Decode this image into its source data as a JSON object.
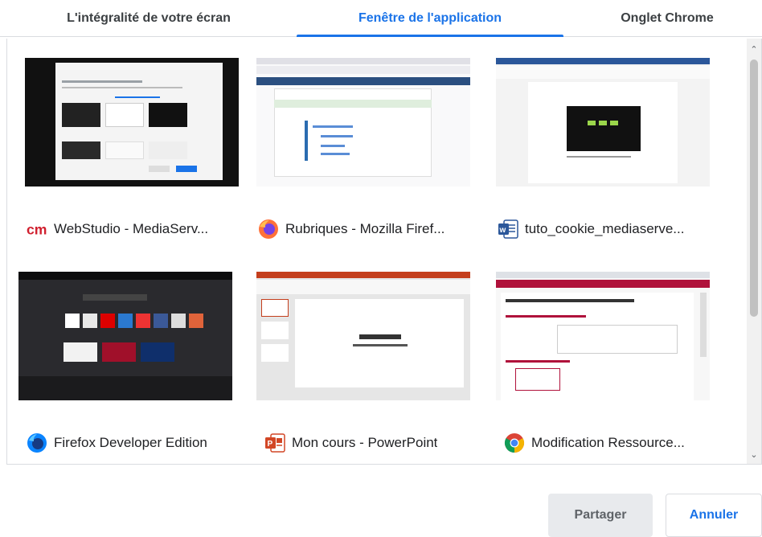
{
  "tabs": [
    {
      "label": "L'intégralité de votre écran",
      "selected": false
    },
    {
      "label": "Fenêtre de l'application",
      "selected": true
    },
    {
      "label": "Onglet Chrome",
      "selected": false
    }
  ],
  "windows": [
    {
      "title": "WebStudio - MediaServ...",
      "icon": "cm-logo-icon"
    },
    {
      "title": "Rubriques - Mozilla Firef...",
      "icon": "firefox-icon"
    },
    {
      "title": "tuto_cookie_mediaserve...",
      "icon": "word-icon"
    },
    {
      "title": "Firefox Developer Edition",
      "icon": "firefox-developer-icon"
    },
    {
      "title": "Mon cours - PowerPoint",
      "icon": "powerpoint-icon"
    },
    {
      "title": "Modification Ressource...",
      "icon": "chrome-icon"
    }
  ],
  "buttons": {
    "share": "Partager",
    "cancel": "Annuler"
  },
  "colors": {
    "accent": "#1a73e8",
    "cm_red": "#d01f2e",
    "word_blue": "#2b579a",
    "ppt_orange": "#d24726"
  }
}
